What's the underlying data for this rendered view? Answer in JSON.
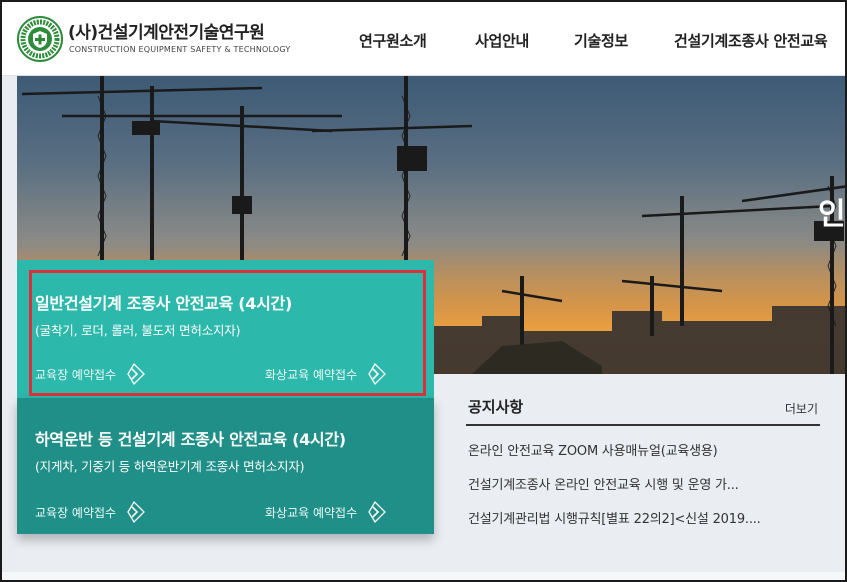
{
  "brand": {
    "name_ko": "(사)건설기계안전기술연구원",
    "name_en": "CONSTRUCTION EQUIPMENT SAFETY & TECHNOLOGY"
  },
  "nav": [
    {
      "label": "연구원소개"
    },
    {
      "label": "사업안내"
    },
    {
      "label": "기술정보"
    },
    {
      "label": "건설기계조종사 안전교육"
    }
  ],
  "hero": {
    "partial_text": "인"
  },
  "cards": [
    {
      "title": "일반건설기계 조종사 안전교육 (4시간)",
      "subtitle": "(굴착기, 로더, 롤러, 불도저 면허소지자)",
      "link_left": "교육장 예약접수",
      "link_right": "화상교육 예약접수"
    },
    {
      "title": "하역운반 등 건설기계 조종사 안전교육 (4시간)",
      "subtitle": "(지게차, 기중기 등 하역운반기계 조종사 면허소지자)",
      "link_left": "교육장 예약접수",
      "link_right": "화상교육 예약접수"
    }
  ],
  "notice": {
    "title": "공지사항",
    "more": "더보기",
    "items": [
      "온라인 안전교육 ZOOM 사용매뉴얼(교육생용)",
      "건설기계조종사 온라인 안전교육 시행 및 운영 가...",
      "건설기계관리법 시행규칙[별표 22의2]<신설 2019...."
    ]
  },
  "colors": {
    "card1": "#2db8ac",
    "card2": "#1f8f88",
    "highlight": "#d9303a",
    "logo_green": "#2e8b3a"
  }
}
